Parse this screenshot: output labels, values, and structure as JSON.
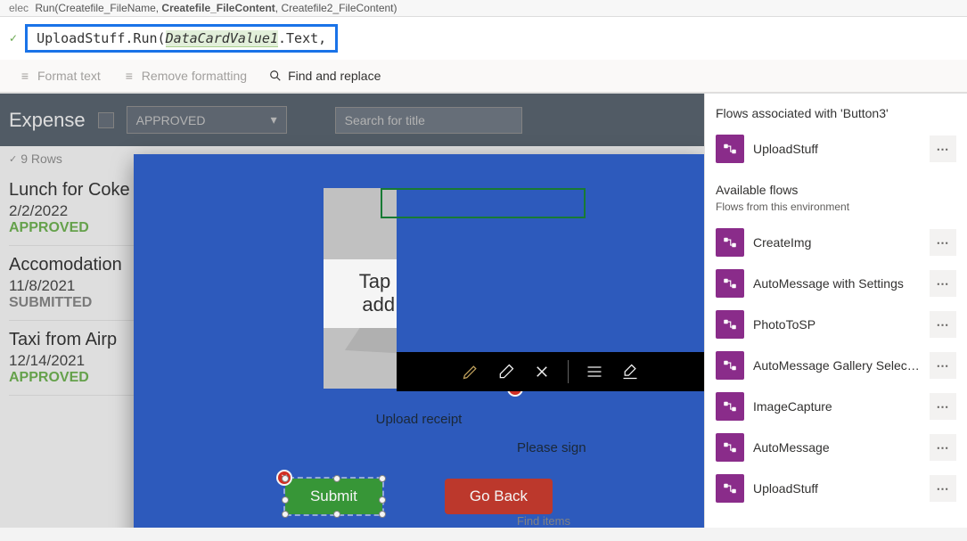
{
  "intellisense": {
    "label": "elec",
    "signature": "Run(Createfile_FileName, Createfile_FileContent, Createfile2_FileContent)"
  },
  "formula": {
    "prefix": "UploadStuff.Run(",
    "highlighted": "DataCardValue1",
    "suffix": ".Text,"
  },
  "toolbar": {
    "format": "Format text",
    "remove": "Remove formatting",
    "find": "Find and replace"
  },
  "header": {
    "title": "Expense",
    "dropdown": "APPROVED",
    "search_placeholder": "Search for title",
    "rowcount": "9 Rows"
  },
  "expenses": [
    {
      "title": "Lunch for Coke",
      "date": "2/2/2022",
      "status": "APPROVED",
      "statusClass": "approved"
    },
    {
      "title": "Accomodation",
      "date": "11/8/2021",
      "status": "SUBMITTED",
      "statusClass": "submitted"
    },
    {
      "title": "Taxi from Airp",
      "date": "12/14/2021",
      "status": "APPROVED",
      "statusClass": "approved"
    }
  ],
  "modal": {
    "tap_line1": "Tap or click to",
    "tap_line2": "add a picture",
    "upload_caption": "Upload receipt",
    "sign_caption": "Please sign",
    "submit": "Submit",
    "goback": "Go Back"
  },
  "panel": {
    "assoc_title": "Flows associated with 'Button3'",
    "assoc_flow": "UploadStuff",
    "avail_title": "Available flows",
    "avail_sub": "Flows from this environment",
    "flows": [
      "CreateImg",
      "AutoMessage with Settings",
      "PhotoToSP",
      "AutoMessage Gallery Select...",
      "ImageCapture",
      "AutoMessage",
      "UploadStuff"
    ]
  },
  "footer_hint": "Find items"
}
